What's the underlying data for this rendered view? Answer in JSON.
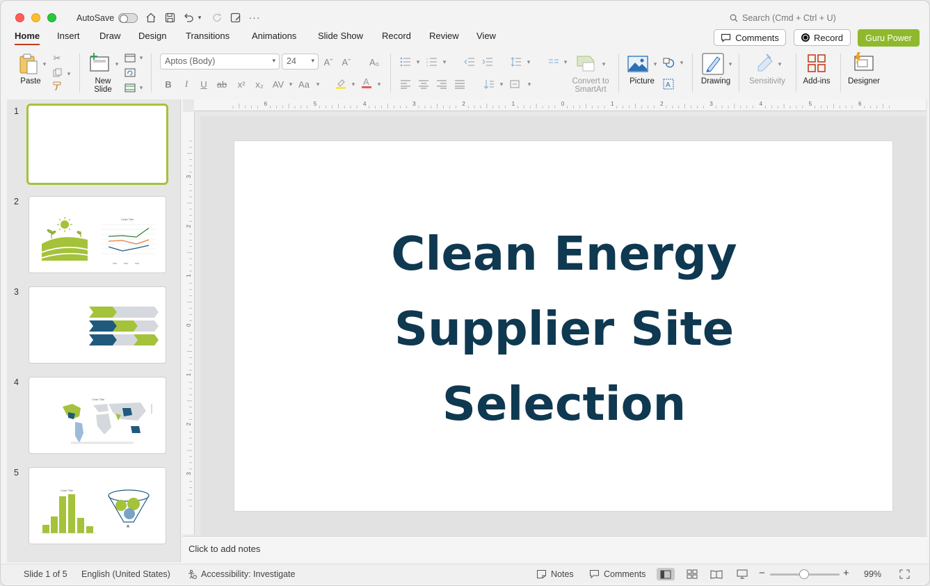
{
  "titlebar": {
    "autosave_label": "AutoSave",
    "search_placeholder": "Search (Cmd + Ctrl + U)"
  },
  "tabs": [
    "Home",
    "Insert",
    "Draw",
    "Design",
    "Transitions",
    "Animations",
    "Slide Show",
    "Record",
    "Review",
    "View"
  ],
  "active_tab": "Home",
  "header_buttons": {
    "comments": "Comments",
    "record": "Record",
    "guru": "Guru Power"
  },
  "ribbon": {
    "paste": "Paste",
    "new_slide_line1": "New",
    "new_slide_line2": "Slide",
    "font_name": "Aptos (Body)",
    "font_size": "24",
    "convert_line1": "Convert to",
    "convert_line2": "SmartArt",
    "picture": "Picture",
    "drawing": "Drawing",
    "sensitivity": "Sensitivity",
    "addins": "Add-ins",
    "designer": "Designer"
  },
  "thumbnails": [
    {
      "num": "1"
    },
    {
      "num": "2",
      "chart_title": "Chart Title"
    },
    {
      "num": "3"
    },
    {
      "num": "4",
      "chart_title": "Chart Title"
    },
    {
      "num": "5",
      "chart_title": "Chart Title"
    }
  ],
  "slide": {
    "title_line1": "Clean Energy",
    "title_line2": "Supplier Site",
    "title_line3": "Selection"
  },
  "ruler_h_labels": [
    "6",
    "5",
    "4",
    "3",
    "2",
    "1",
    "0",
    "1",
    "2",
    "3",
    "4",
    "5",
    "6"
  ],
  "ruler_v_labels": [
    "3",
    "2",
    "1",
    "0",
    "1",
    "2",
    "3"
  ],
  "notes_placeholder": "Click to add notes",
  "status": {
    "slide_of": "Slide 1 of 5",
    "language": "English (United States)",
    "accessibility": "Accessibility: Investigate",
    "notes": "Notes",
    "comments": "Comments",
    "zoom": "99%"
  },
  "colors": {
    "accent_green": "#8fb92d",
    "title_navy": "#0f3851",
    "chevron_blue": "#1f5a7d",
    "tab_underline": "#c43e1c"
  }
}
